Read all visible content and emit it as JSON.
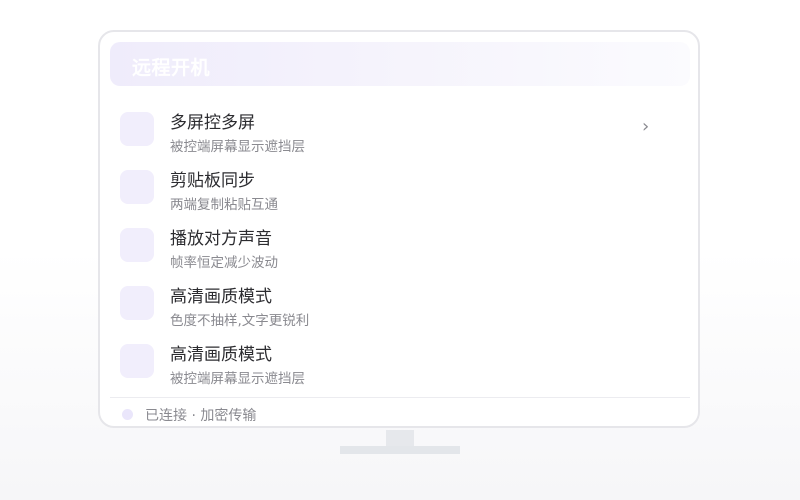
{
  "header": {
    "title": "远程开机"
  },
  "items": [
    {
      "title": "多屏控多屏",
      "subtitle": "被控端屏幕显示遮挡层",
      "chevron": "›"
    },
    {
      "title": "剪贴板同步",
      "subtitle": "两端复制粘贴互通"
    },
    {
      "title": "播放对方声音",
      "subtitle": "帧率恒定减少波动"
    },
    {
      "title": "高清画质模式",
      "subtitle": "色度不抽样,文字更锐利"
    },
    {
      "title": "高清画质模式",
      "subtitle": "被控端屏幕显示遮挡层"
    }
  ],
  "status": {
    "text": "已连接 · 加密传输"
  },
  "colors": {
    "accent_light": "#efecfb",
    "icon_bg": "#f1eefc",
    "text_primary": "#2c2c30",
    "text_secondary": "#8a8a90",
    "border": "#e6e6ea"
  },
  "icons": {
    "item_chevron": "chevron-right-icon",
    "status_indicator": "status-dot-icon"
  }
}
